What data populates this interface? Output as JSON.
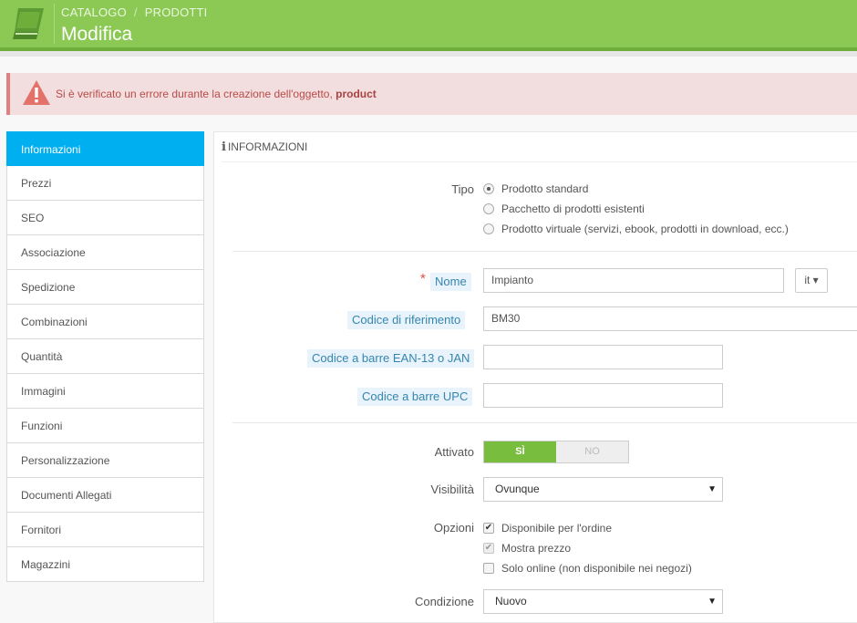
{
  "header": {
    "breadcrumb": [
      "CATALOGO",
      "PRODOTTI"
    ],
    "breadcrumb_sep": "/",
    "title": "Modifica",
    "icon": "book-icon"
  },
  "alert": {
    "message": "Si è verificato un errore durante la creazione dell'oggetto, ",
    "object": "product",
    "icon": "warning-icon"
  },
  "sidebar": {
    "items": [
      {
        "label": "Informazioni",
        "active": true
      },
      {
        "label": "Prezzi"
      },
      {
        "label": "SEO"
      },
      {
        "label": "Associazione"
      },
      {
        "label": "Spedizione"
      },
      {
        "label": "Combinazioni"
      },
      {
        "label": "Quantità"
      },
      {
        "label": "Immagini"
      },
      {
        "label": "Funzioni"
      },
      {
        "label": "Personalizzazione"
      },
      {
        "label": "Documenti Allegati"
      },
      {
        "label": "Fornitori"
      },
      {
        "label": "Magazzini"
      }
    ]
  },
  "panel": {
    "heading": "INFORMAZIONI",
    "tipo": {
      "label": "Tipo",
      "options": [
        "Prodotto standard",
        "Pacchetto di prodotti esistenti",
        "Prodotto virtuale (servizi, ebook, prodotti in download, ecc.)"
      ],
      "selected": 0
    },
    "nome": {
      "label": "Nome",
      "value": "Impianto",
      "lang": "it ▾",
      "required": "*"
    },
    "riferimento": {
      "label": "Codice di riferimento",
      "value": "BM30"
    },
    "ean": {
      "label": "Codice a barre EAN-13 o JAN",
      "value": ""
    },
    "upc": {
      "label": "Codice a barre UPC",
      "value": ""
    },
    "attivato": {
      "label": "Attivato",
      "on": "SÌ",
      "off": "NO"
    },
    "visibilita": {
      "label": "Visibilità",
      "value": "Ovunque"
    },
    "opzioni": {
      "label": "Opzioni",
      "items": [
        {
          "label": "Disponibile per l'ordine",
          "checked": true
        },
        {
          "label": "Mostra prezzo",
          "checked": true,
          "disabled": true
        },
        {
          "label": "Solo online (non disponibile nei negozi)",
          "checked": false
        }
      ]
    },
    "condizione": {
      "label": "Condizione",
      "value": "Nuovo"
    }
  },
  "colors": {
    "header": "#8bc954",
    "accent": "#00aff0",
    "switch_on": "#79bd3f",
    "alert_bg": "#f2dede"
  }
}
